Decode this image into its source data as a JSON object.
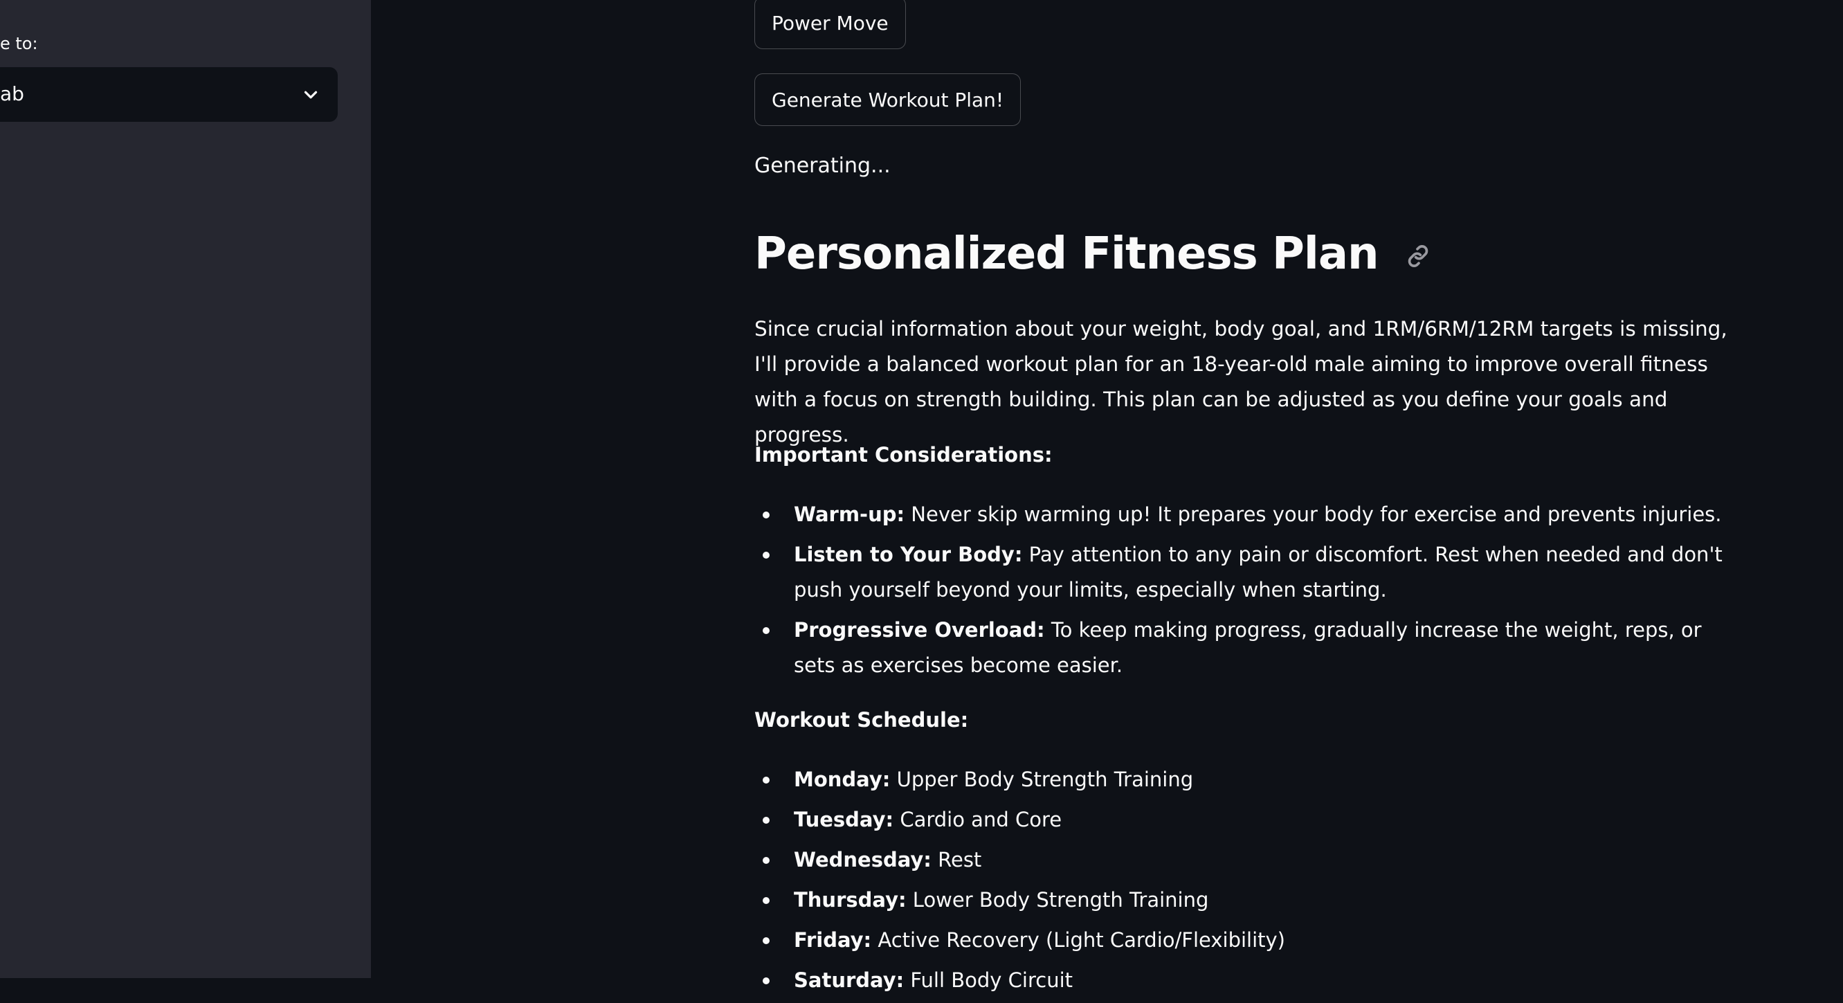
{
  "sidebar": {
    "label": "e to:",
    "select_value": "ab"
  },
  "main": {
    "power_move_button": "Power Move",
    "generate_button": "Generate Workout Plan!",
    "status": "Generating...",
    "title": "Personalized Fitness Plan",
    "intro": "Since crucial information about your weight, body goal, and 1RM/6RM/12RM targets is missing, I'll provide a balanced workout plan for an 18-year-old male aiming to improve overall fitness with a focus on strength building. This plan can be adjusted as you define your goals and progress.",
    "considerations_heading": "Important Considerations:",
    "considerations": [
      {
        "term": "Warm-up:",
        "text": " Never skip warming up! It prepares your body for exercise and prevents injuries."
      },
      {
        "term": "Listen to Your Body:",
        "text": " Pay attention to any pain or discomfort. Rest when needed and don't push yourself beyond your limits, especially when starting."
      },
      {
        "term": "Progressive Overload:",
        "text": " To keep making progress, gradually increase the weight, reps, or sets as exercises become easier."
      }
    ],
    "schedule_heading": "Workout Schedule:",
    "schedule": [
      {
        "term": "Monday:",
        "text": " Upper Body Strength Training"
      },
      {
        "term": "Tuesday:",
        "text": " Cardio and Core"
      },
      {
        "term": "Wednesday:",
        "text": " Rest"
      },
      {
        "term": "Thursday:",
        "text": " Lower Body Strength Training"
      },
      {
        "term": "Friday:",
        "text": " Active Recovery (Light Cardio/Flexibility)"
      },
      {
        "term": "Saturday:",
        "text": " Full Body Circuit"
      }
    ]
  },
  "icons": {
    "select_chevron": "chevron-down-icon",
    "heading_anchor": "link-icon"
  }
}
